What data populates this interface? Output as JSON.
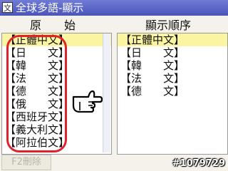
{
  "title": "全球多語-顯示",
  "left_header": "原　　始",
  "right_header": "顯示順序",
  "left_items": [
    "【正體中文】",
    "【日　　文】",
    "【韓　　文】",
    "【法　　文】",
    "【德　　文】",
    "【俄　　文】",
    "【西班牙文】",
    "【義大利文】",
    "【阿拉伯文】"
  ],
  "right_items": [
    "【正體中文】",
    "【日　　文】",
    "【韓　　文】",
    "【法　　文】",
    "【德　　文】"
  ],
  "delete_button": "F2刪除",
  "photo_id": "#1079729",
  "icons": {
    "app": "globe-icon",
    "arrow": "pointing-hand-icon"
  },
  "colors": {
    "titlebar": "#5a64c8",
    "selected": "#fbf4a0",
    "annotation": "#e0222a"
  }
}
